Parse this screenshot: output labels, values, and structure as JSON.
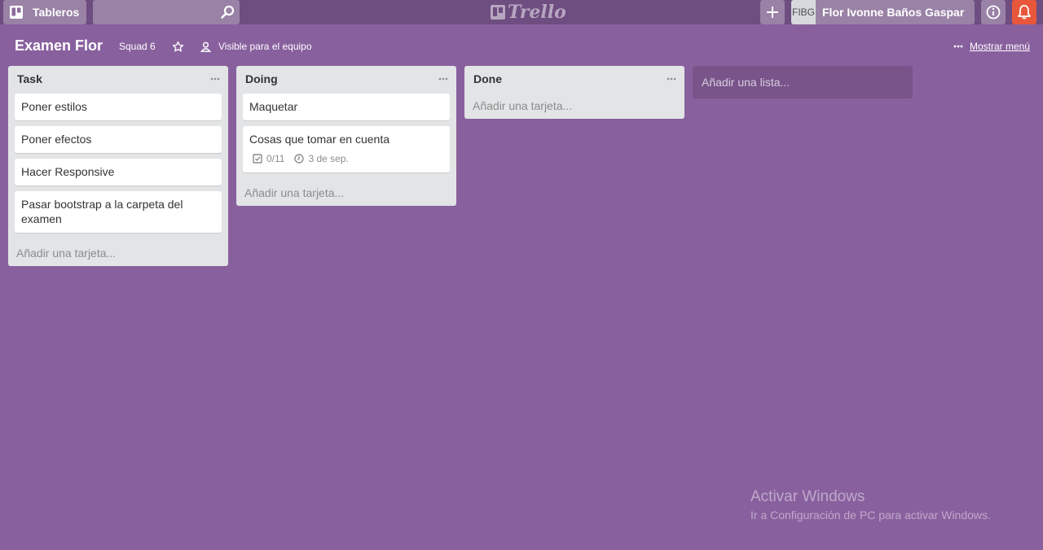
{
  "header": {
    "boards_label": "Tableros",
    "search_placeholder": "",
    "logo_text": "Trello",
    "user_initials": "FIBG",
    "user_name": "Flor Ivonne Baños Gaspar"
  },
  "board": {
    "title": "Examen Flor",
    "team": "Squad 6",
    "visibility": "Visible para el equipo",
    "show_menu": "Mostrar menú"
  },
  "lists": [
    {
      "title": "Task",
      "cards": [
        {
          "title": "Poner estilos"
        },
        {
          "title": "Poner efectos"
        },
        {
          "title": "Hacer Responsive"
        },
        {
          "title": "Pasar bootstrap a la carpeta del examen"
        }
      ],
      "add_card": "Añadir una tarjeta..."
    },
    {
      "title": "Doing",
      "cards": [
        {
          "title": "Maquetar"
        },
        {
          "title": "Cosas que tomar en cuenta",
          "checklist": "0/11",
          "due": "3 de sep."
        }
      ],
      "add_card": "Añadir una tarjeta..."
    },
    {
      "title": "Done",
      "cards": [],
      "add_card": "Añadir una tarjeta..."
    }
  ],
  "add_list": "Añadir una lista...",
  "watermark": {
    "line1": "Activar Windows",
    "line2": "Ir a Configuración de PC para activar Windows."
  },
  "colors": {
    "background": "#89609e",
    "header": "#6e4d80",
    "notification": "#e8573c"
  }
}
